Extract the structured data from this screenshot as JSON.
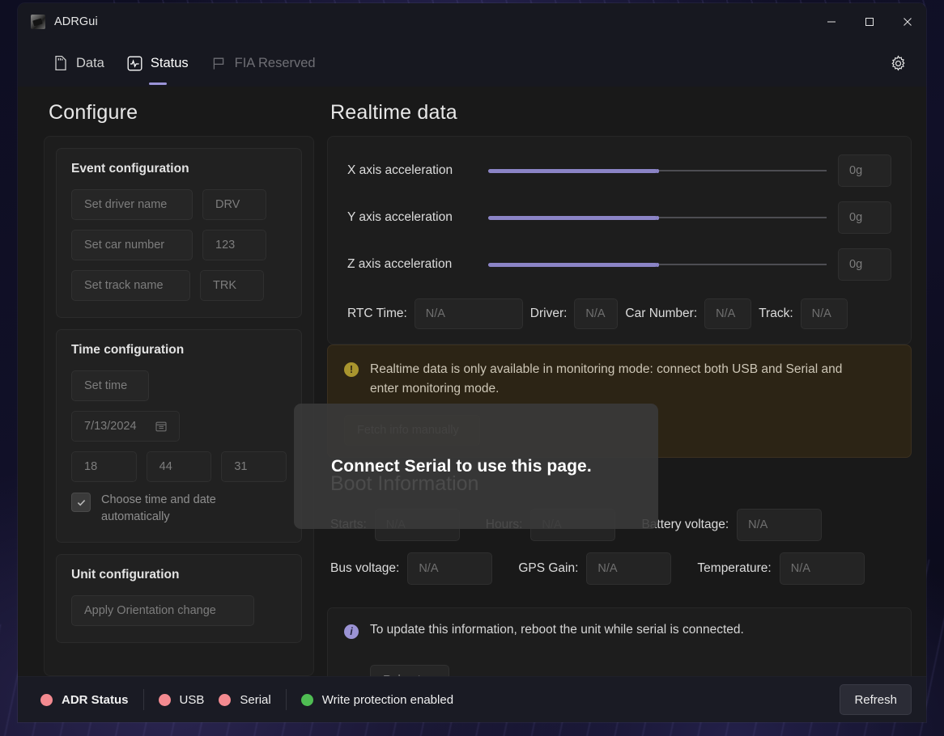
{
  "window": {
    "title": "ADRGui",
    "minimize": "–",
    "maximize": "□",
    "close": "✕"
  },
  "tabs": [
    {
      "label": "Data",
      "icon": "sd-card-icon",
      "state": "inactive"
    },
    {
      "label": "Status",
      "icon": "activity-pulse-icon",
      "state": "active"
    },
    {
      "label": "FIA Reserved",
      "icon": "flag-icon",
      "state": "disabled"
    }
  ],
  "settings_icon": "gear-icon",
  "configure": {
    "heading": "Configure",
    "event": {
      "title": "Event configuration",
      "set_driver_name": "Set driver name",
      "driver_value": "DRV",
      "set_car_number": "Set car number",
      "car_value": "123",
      "set_track_name": "Set track name",
      "track_value": "TRK"
    },
    "time": {
      "title": "Time configuration",
      "set_time": "Set time",
      "date_value": "7/13/2024",
      "calendar_icon": "calendar-icon",
      "hour": "18",
      "minute": "44",
      "second": "31",
      "auto_label": "Choose time and date automatically",
      "auto_checked": true,
      "check_icon": "check-icon"
    },
    "unit": {
      "title": "Unit configuration",
      "apply_orientation": "Apply Orientation change"
    }
  },
  "realtime": {
    "heading": "Realtime data",
    "sliders": [
      {
        "label": "X axis acceleration",
        "value": "0g",
        "percent": 50
      },
      {
        "label": "Y axis acceleration",
        "value": "0g",
        "percent": 50
      },
      {
        "label": "Z axis acceleration",
        "value": "0g",
        "percent": 50
      }
    ],
    "info": [
      {
        "label": "RTC Time:",
        "value": "N/A"
      },
      {
        "label": "Driver:",
        "value": "N/A"
      },
      {
        "label": "Car Number:",
        "value": "N/A"
      },
      {
        "label": "Track:",
        "value": "N/A"
      }
    ],
    "warning": {
      "icon": "warning-icon",
      "text": "Realtime data is only available in monitoring mode: connect both USB and Serial and enter monitoring mode.",
      "fetch_button": "Fetch info manually"
    }
  },
  "boot": {
    "heading": "Boot Information",
    "row1": [
      {
        "label": "Starts:",
        "value": "N/A"
      },
      {
        "label": "Hours:",
        "value": "N/A"
      },
      {
        "label": "Battery voltage:",
        "value": "N/A"
      }
    ],
    "row2": [
      {
        "label": "Bus voltage:",
        "value": "N/A"
      },
      {
        "label": "GPS Gain:",
        "value": "N/A"
      },
      {
        "label": "Temperature:",
        "value": "N/A"
      }
    ],
    "info": {
      "icon": "info-icon",
      "text": "To update this information, reboot the unit while serial is connected.",
      "reboot_button": "Reboot"
    }
  },
  "modal": {
    "text": "Connect Serial to use this page."
  },
  "statusbar": {
    "items": [
      {
        "label": "ADR Status",
        "color": "#f38a90",
        "bold": true
      },
      {
        "label": "USB",
        "color": "#f38a90",
        "bold": false
      },
      {
        "label": "Serial",
        "color": "#f38a90",
        "bold": false
      },
      {
        "label": "Write protection enabled",
        "color": "#4fbd53",
        "bold": false
      }
    ],
    "refresh": "Refresh"
  },
  "colors": {
    "accent": "#8b84c6",
    "tab_underline": "#9b94d8",
    "status_red": "#f38a90",
    "status_green": "#4fbd53",
    "warning_bg": "#2c2415",
    "window_bg": "#191919"
  }
}
